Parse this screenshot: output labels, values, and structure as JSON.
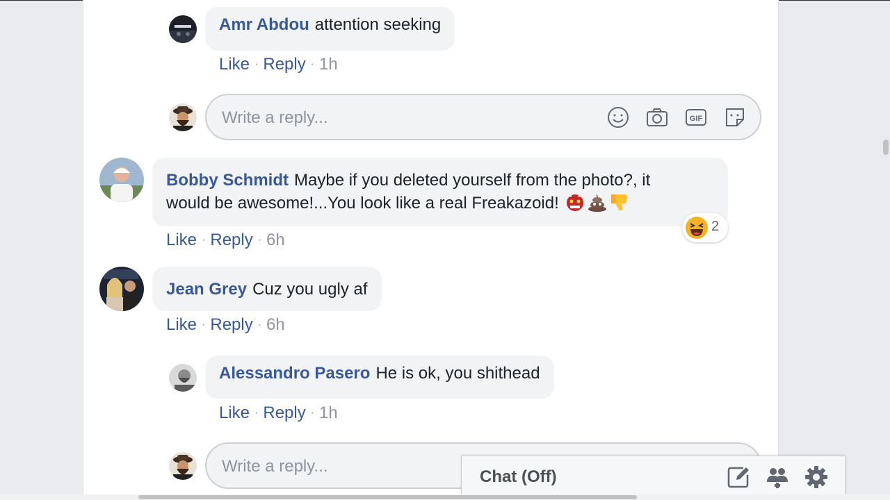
{
  "comments": [
    {
      "author": "Amr Abdou",
      "text": "attention seeking",
      "like": "Like",
      "reply": "Reply",
      "time": "1h"
    },
    {
      "author": "Bobby Schmidt",
      "text_line1": "Maybe if you deleted yourself from the photo?, it",
      "text_line2": "would be awesome!...You look like a real Freakazoid!",
      "emojis": [
        "ogre-emoji",
        "pile-of-poo-emoji",
        "thumbs-down-emoji"
      ],
      "like": "Like",
      "reply": "Reply",
      "time": "6h",
      "reaction": {
        "icon": "laughing-emoji",
        "count": "2"
      }
    },
    {
      "author": "Jean Grey",
      "text": "Cuz you ugly af",
      "like": "Like",
      "reply": "Reply",
      "time": "6h"
    },
    {
      "author": "Alessandro Pasero",
      "text": "He is ok, you shithead",
      "like": "Like",
      "reply": "Reply",
      "time": "1h"
    }
  ],
  "reply_box": {
    "placeholder": "Write a reply...",
    "tools": [
      "smiley-icon",
      "camera-icon",
      "gif-icon",
      "sticker-icon"
    ]
  },
  "separator": "·",
  "chat": {
    "title": "Chat (Off)",
    "icons": [
      "compose-icon",
      "group-icon",
      "gear-icon"
    ]
  },
  "colors": {
    "link": "#385898",
    "meta": "#90949c",
    "bubble": "#f2f3f5",
    "page_bg": "#e9ebee"
  }
}
